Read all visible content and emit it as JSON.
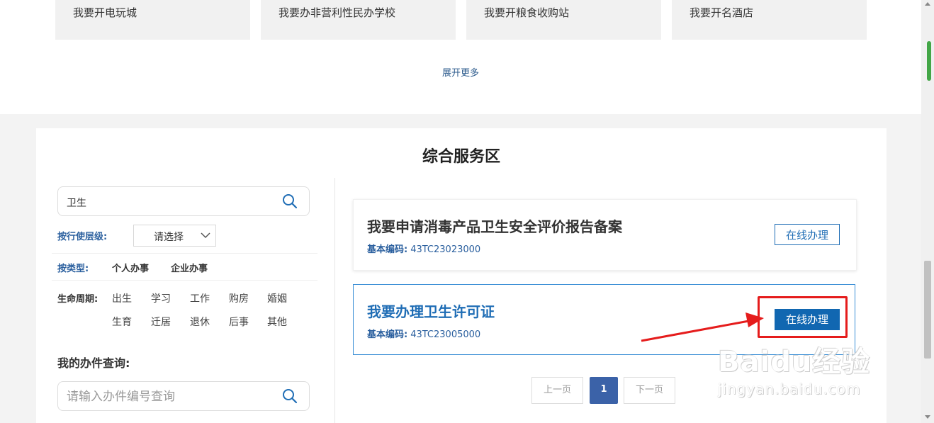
{
  "quick_links": [
    "我要开电玩城",
    "我要办非营利性民办学校",
    "我要开粮食收购站",
    "我要开名酒店"
  ],
  "expand_more": "展开更多",
  "section_title": "综合服务区",
  "search": {
    "value": "卫生"
  },
  "filters": {
    "level_label": "按行使层级:",
    "level_select": "请选择",
    "type_label": "按类型:",
    "types": [
      "个人办事",
      "企业办事"
    ],
    "life_label": "生命周期:",
    "life_items": [
      "出生",
      "学习",
      "工作",
      "购房",
      "婚姻",
      "生育",
      "迁居",
      "退休",
      "后事",
      "其他"
    ]
  },
  "query": {
    "title": "我的办件查询:",
    "placeholder": "请输入办件编号查询"
  },
  "results": [
    {
      "title": "我要申请消毒产品卫生安全评价报告备案",
      "code_label": "基本编码:",
      "code": "43TC23023000",
      "button": "在线办理"
    },
    {
      "title": "我要办理卫生许可证",
      "code_label": "基本编码:",
      "code": "43TC23005000",
      "button": "在线办理"
    }
  ],
  "pager": {
    "prev": "上一页",
    "current": "1",
    "next": "下一页"
  },
  "watermark": {
    "main": "Baidu经验",
    "sub": "jingyan.baidu.com"
  },
  "colors": {
    "accent_blue": "#1f6db5",
    "highlight_red": "#e51c1c",
    "pager_active": "#3b62a8"
  },
  "scrollbar": {
    "position": 0.62
  }
}
